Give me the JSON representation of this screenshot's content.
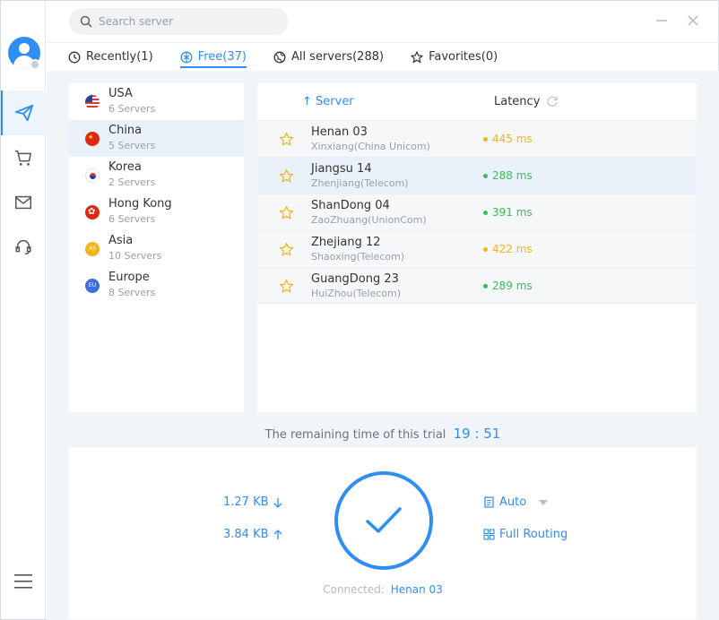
{
  "search": {
    "placeholder": "Search server"
  },
  "tabs": [
    {
      "label": "Recently(1)",
      "icon": "clock-icon"
    },
    {
      "label": "Free(37)",
      "icon": "free-icon"
    },
    {
      "label": "All servers(288)",
      "icon": "globe-icon"
    },
    {
      "label": "Favorites(0)",
      "icon": "star-icon"
    }
  ],
  "regions": [
    {
      "name": "USA",
      "count": "6 Servers",
      "flag": "us-flag-icon"
    },
    {
      "name": "China",
      "count": "5 Servers",
      "flag": "cn-flag-icon"
    },
    {
      "name": "Korea",
      "count": "2 Servers",
      "flag": "kr-flag-icon"
    },
    {
      "name": "Hong Kong",
      "count": "6 Servers",
      "flag": "hk-flag-icon"
    },
    {
      "name": "Asia",
      "count": "10 Servers",
      "flag": "asia-flag-icon",
      "badge": "AS"
    },
    {
      "name": "Europe",
      "count": "8 Servers",
      "flag": "eu-flag-icon",
      "badge": "EU"
    }
  ],
  "server_table": {
    "col_server": "↑ Server",
    "col_latency": "Latency"
  },
  "servers": [
    {
      "name": "Henan 03",
      "location": "Xinxiang(China Unicom)",
      "latency": "445 ms",
      "status_color": "#f5b417"
    },
    {
      "name": "Jiangsu 14",
      "location": "Zhenjiang(Telecom)",
      "latency": "288 ms",
      "status_color": "#3fba5c"
    },
    {
      "name": "ShanDong 04",
      "location": "ZaoZhuang(UnionCom)",
      "latency": "391 ms",
      "status_color": "#3fba5c"
    },
    {
      "name": "Zhejiang 12",
      "location": "Shaoxing(Telecom)",
      "latency": "422 ms",
      "status_color": "#f5b417"
    },
    {
      "name": "GuangDong 23",
      "location": "HuiZhou(Telecom)",
      "latency": "289 ms",
      "status_color": "#3fba5c"
    }
  ],
  "trial": {
    "label": "The remaining time of this trial",
    "time": "19 : 51"
  },
  "stats": {
    "download": "1.27 KB",
    "upload": "3.84 KB"
  },
  "options": {
    "mode": "Auto",
    "routing": "Full Routing"
  },
  "status": {
    "label": "Connected:",
    "server": "Henan 03"
  },
  "colors": {
    "accent": "#2f8ef5",
    "good": "#3fba5c",
    "warn": "#f5b417"
  }
}
